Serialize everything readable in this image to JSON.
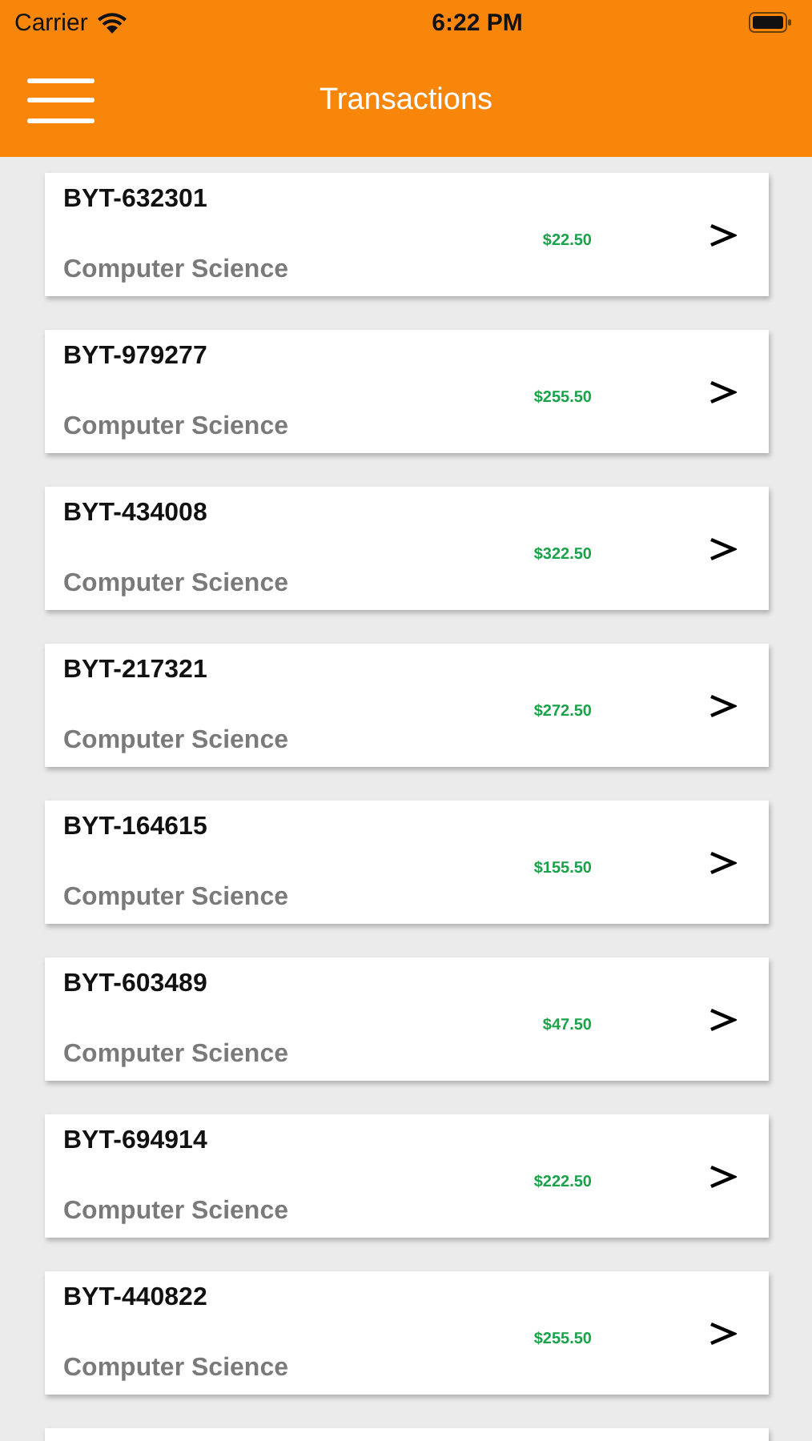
{
  "status_bar": {
    "carrier": "Carrier",
    "time": "6:22 PM"
  },
  "header": {
    "title": "Transactions"
  },
  "transactions": [
    {
      "id": "BYT-632301",
      "amount": "$22.50",
      "category": "Computer Science"
    },
    {
      "id": "BYT-979277",
      "amount": "$255.50",
      "category": "Computer Science"
    },
    {
      "id": "BYT-434008",
      "amount": "$322.50",
      "category": "Computer Science"
    },
    {
      "id": "BYT-217321",
      "amount": "$272.50",
      "category": "Computer Science"
    },
    {
      "id": "BYT-164615",
      "amount": "$155.50",
      "category": "Computer Science"
    },
    {
      "id": "BYT-603489",
      "amount": "$47.50",
      "category": "Computer Science"
    },
    {
      "id": "BYT-694914",
      "amount": "$222.50",
      "category": "Computer Science"
    },
    {
      "id": "BYT-440822",
      "amount": "$255.50",
      "category": "Computer Science"
    }
  ]
}
